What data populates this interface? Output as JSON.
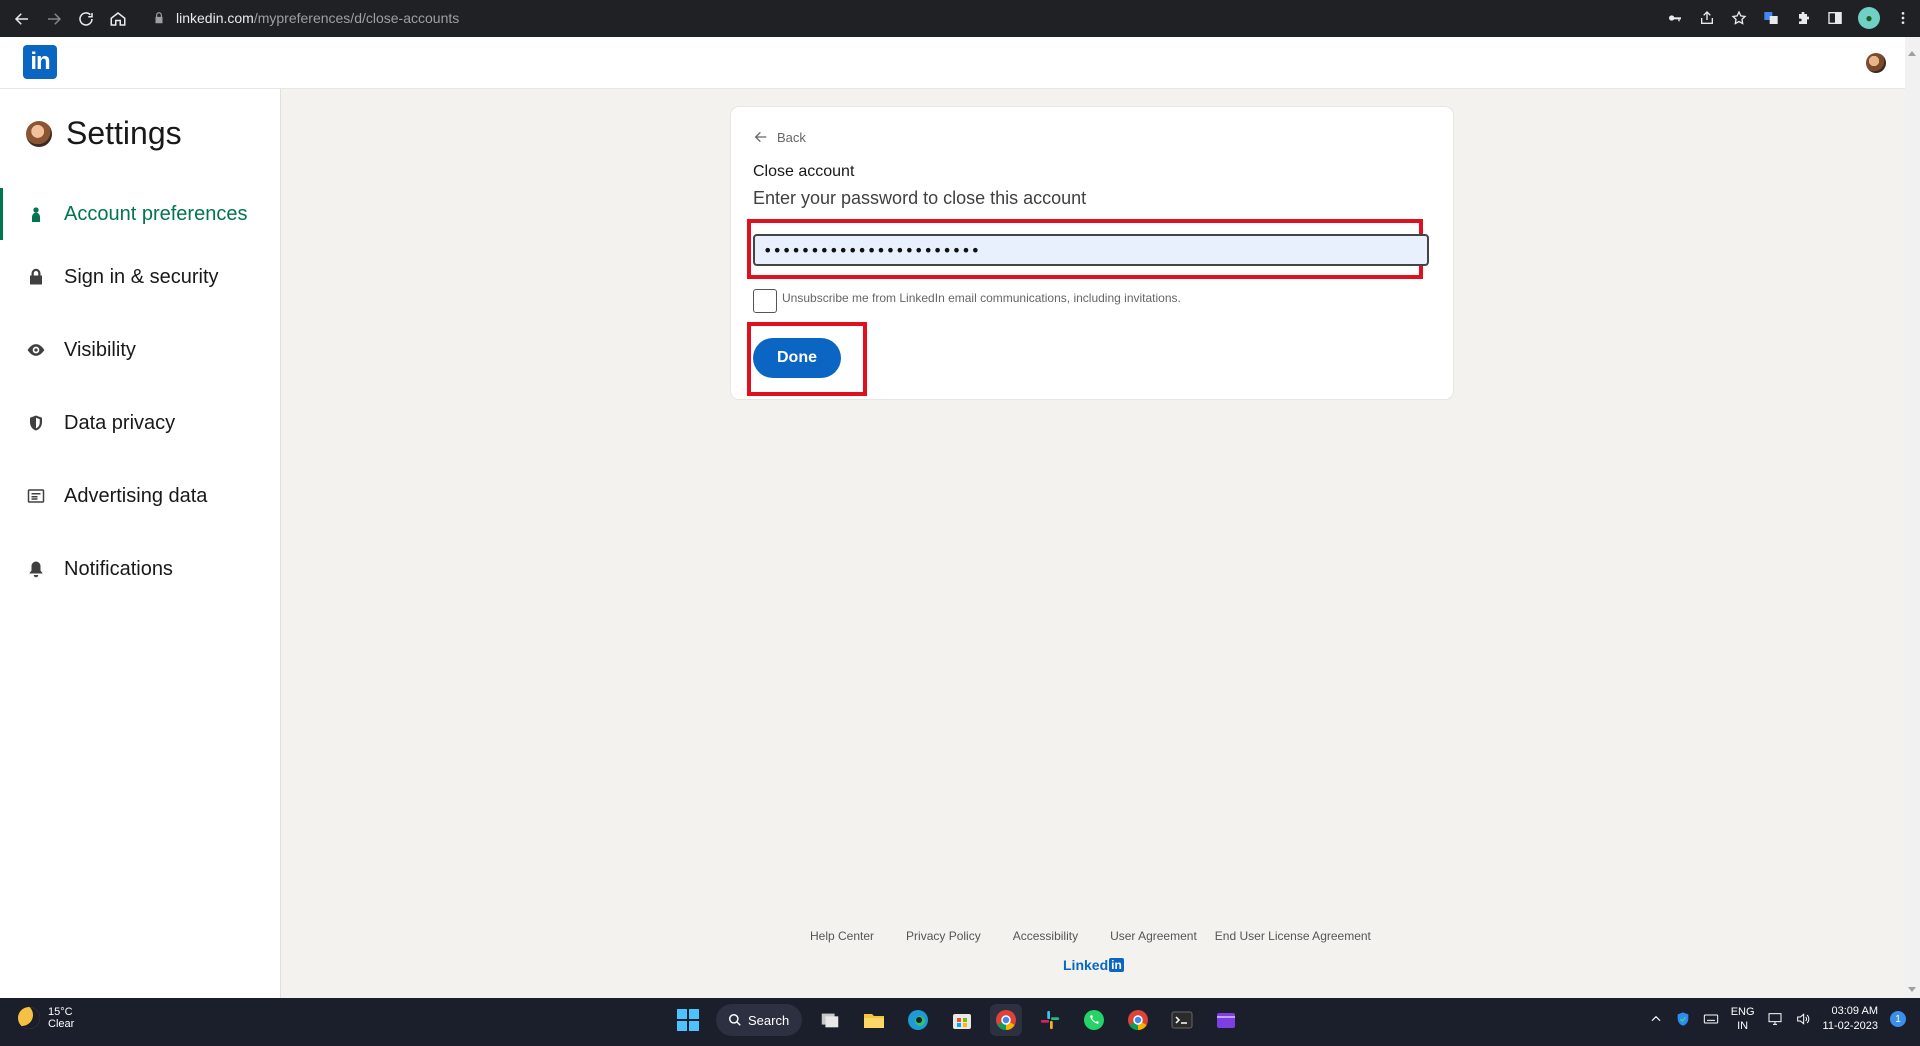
{
  "browser": {
    "url_host": "linkedin.com",
    "url_path": "/mypreferences/d/close-accounts"
  },
  "header": {
    "logo_text": "in"
  },
  "sidebar": {
    "title": "Settings",
    "items": [
      {
        "label": "Account preferences",
        "icon": "person-icon",
        "active": true
      },
      {
        "label": "Sign in & security",
        "icon": "lock-icon",
        "active": false
      },
      {
        "label": "Visibility",
        "icon": "eye-icon",
        "active": false
      },
      {
        "label": "Data privacy",
        "icon": "shield-icon",
        "active": false
      },
      {
        "label": "Advertising data",
        "icon": "ad-card-icon",
        "active": false
      },
      {
        "label": "Notifications",
        "icon": "bell-icon",
        "active": false
      }
    ]
  },
  "card": {
    "back_label": "Back",
    "title": "Close account",
    "subtitle": "Enter your password to close this account",
    "password_value": "•••••••••••••••••••••••",
    "checkbox_label": "Unsubscribe me from LinkedIn email communications, including invitations.",
    "checkbox_checked": false,
    "done_label": "Done"
  },
  "footer": {
    "links": [
      "Help Center",
      "Privacy Policy",
      "Accessibility",
      "User Agreement",
      "End User License Agreement"
    ],
    "brand": "Linked",
    "brand_box": "in"
  },
  "taskbar": {
    "temperature": "15°C",
    "weather": "Clear",
    "search_label": "Search",
    "lang_top": "ENG",
    "lang_bottom": "IN",
    "time": "03:09 AM",
    "date": "11-02-2023",
    "notification_count": "1"
  },
  "colors": {
    "linkedin_blue": "#0a66c2",
    "active_green": "#01754f",
    "highlight_red": "#e0101e"
  }
}
